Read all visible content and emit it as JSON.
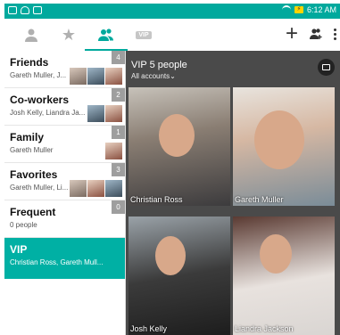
{
  "status_bar": {
    "time": "6:12 AM",
    "battery_icon": "battery-charging-icon",
    "wifi_icon": "wifi-icon"
  },
  "tabs": [
    {
      "name": "contacts",
      "icon": "person-icon"
    },
    {
      "name": "favorites",
      "icon": "star-icon"
    },
    {
      "name": "groups",
      "icon": "group-icon",
      "selected": true
    },
    {
      "name": "vip",
      "icon": "vip-icon",
      "label": "VIP"
    }
  ],
  "toolbar_actions": [
    "add-icon",
    "add-group-icon",
    "more-options-icon"
  ],
  "groups": [
    {
      "name": "Friends",
      "members": "Gareth Muller, J...",
      "count": "4"
    },
    {
      "name": "Co-workers",
      "members": "Josh Kelly, Liandra Ja...",
      "count": "2"
    },
    {
      "name": "Family",
      "members": "Gareth Muller",
      "count": "1"
    },
    {
      "name": "Favorites",
      "members": "Gareth Muller, Li...",
      "count": "3"
    },
    {
      "name": "Frequent",
      "members": "0 people",
      "count": "0"
    },
    {
      "name": "VIP",
      "members": "Christian Ross, Gareth Mull...",
      "selected": true
    }
  ],
  "detail": {
    "title": "VIP 5 people",
    "filter": "All accounts",
    "filter_icon": "chevron-down-icon",
    "edit_icon": "edit-group-icon",
    "contacts": [
      "Christian Ross",
      "Gareth Muller",
      "Josh Kelly",
      "Liandra Jackson"
    ]
  },
  "colors": {
    "accent": "#00a99d",
    "status_bar": "#00a99d",
    "selected_row": "#00b0a4",
    "detail_bg": "#4a4a4a"
  }
}
